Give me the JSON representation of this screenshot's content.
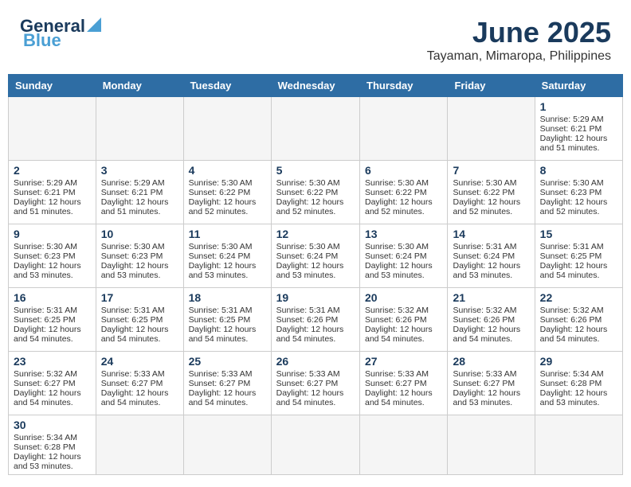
{
  "header": {
    "logo_general": "General",
    "logo_blue": "Blue",
    "month_year": "June 2025",
    "location": "Tayaman, Mimaropa, Philippines"
  },
  "weekdays": [
    "Sunday",
    "Monday",
    "Tuesday",
    "Wednesday",
    "Thursday",
    "Friday",
    "Saturday"
  ],
  "days": [
    {
      "num": "",
      "info": ""
    },
    {
      "num": "",
      "info": ""
    },
    {
      "num": "",
      "info": ""
    },
    {
      "num": "",
      "info": ""
    },
    {
      "num": "",
      "info": ""
    },
    {
      "num": "",
      "info": ""
    },
    {
      "num": "1",
      "sunrise": "Sunrise: 5:29 AM",
      "sunset": "Sunset: 6:21 PM",
      "daylight": "Daylight: 12 hours",
      "minutes": "and 51 minutes."
    },
    {
      "num": "2",
      "sunrise": "Sunrise: 5:29 AM",
      "sunset": "Sunset: 6:21 PM",
      "daylight": "Daylight: 12 hours",
      "minutes": "and 51 minutes."
    },
    {
      "num": "3",
      "sunrise": "Sunrise: 5:29 AM",
      "sunset": "Sunset: 6:21 PM",
      "daylight": "Daylight: 12 hours",
      "minutes": "and 51 minutes."
    },
    {
      "num": "4",
      "sunrise": "Sunrise: 5:30 AM",
      "sunset": "Sunset: 6:22 PM",
      "daylight": "Daylight: 12 hours",
      "minutes": "and 52 minutes."
    },
    {
      "num": "5",
      "sunrise": "Sunrise: 5:30 AM",
      "sunset": "Sunset: 6:22 PM",
      "daylight": "Daylight: 12 hours",
      "minutes": "and 52 minutes."
    },
    {
      "num": "6",
      "sunrise": "Sunrise: 5:30 AM",
      "sunset": "Sunset: 6:22 PM",
      "daylight": "Daylight: 12 hours",
      "minutes": "and 52 minutes."
    },
    {
      "num": "7",
      "sunrise": "Sunrise: 5:30 AM",
      "sunset": "Sunset: 6:22 PM",
      "daylight": "Daylight: 12 hours",
      "minutes": "and 52 minutes."
    },
    {
      "num": "8",
      "sunrise": "Sunrise: 5:30 AM",
      "sunset": "Sunset: 6:23 PM",
      "daylight": "Daylight: 12 hours",
      "minutes": "and 52 minutes."
    },
    {
      "num": "9",
      "sunrise": "Sunrise: 5:30 AM",
      "sunset": "Sunset: 6:23 PM",
      "daylight": "Daylight: 12 hours",
      "minutes": "and 53 minutes."
    },
    {
      "num": "10",
      "sunrise": "Sunrise: 5:30 AM",
      "sunset": "Sunset: 6:23 PM",
      "daylight": "Daylight: 12 hours",
      "minutes": "and 53 minutes."
    },
    {
      "num": "11",
      "sunrise": "Sunrise: 5:30 AM",
      "sunset": "Sunset: 6:24 PM",
      "daylight": "Daylight: 12 hours",
      "minutes": "and 53 minutes."
    },
    {
      "num": "12",
      "sunrise": "Sunrise: 5:30 AM",
      "sunset": "Sunset: 6:24 PM",
      "daylight": "Daylight: 12 hours",
      "minutes": "and 53 minutes."
    },
    {
      "num": "13",
      "sunrise": "Sunrise: 5:30 AM",
      "sunset": "Sunset: 6:24 PM",
      "daylight": "Daylight: 12 hours",
      "minutes": "and 53 minutes."
    },
    {
      "num": "14",
      "sunrise": "Sunrise: 5:31 AM",
      "sunset": "Sunset: 6:24 PM",
      "daylight": "Daylight: 12 hours",
      "minutes": "and 53 minutes."
    },
    {
      "num": "15",
      "sunrise": "Sunrise: 5:31 AM",
      "sunset": "Sunset: 6:25 PM",
      "daylight": "Daylight: 12 hours",
      "minutes": "and 54 minutes."
    },
    {
      "num": "16",
      "sunrise": "Sunrise: 5:31 AM",
      "sunset": "Sunset: 6:25 PM",
      "daylight": "Daylight: 12 hours",
      "minutes": "and 54 minutes."
    },
    {
      "num": "17",
      "sunrise": "Sunrise: 5:31 AM",
      "sunset": "Sunset: 6:25 PM",
      "daylight": "Daylight: 12 hours",
      "minutes": "and 54 minutes."
    },
    {
      "num": "18",
      "sunrise": "Sunrise: 5:31 AM",
      "sunset": "Sunset: 6:25 PM",
      "daylight": "Daylight: 12 hours",
      "minutes": "and 54 minutes."
    },
    {
      "num": "19",
      "sunrise": "Sunrise: 5:31 AM",
      "sunset": "Sunset: 6:26 PM",
      "daylight": "Daylight: 12 hours",
      "minutes": "and 54 minutes."
    },
    {
      "num": "20",
      "sunrise": "Sunrise: 5:32 AM",
      "sunset": "Sunset: 6:26 PM",
      "daylight": "Daylight: 12 hours",
      "minutes": "and 54 minutes."
    },
    {
      "num": "21",
      "sunrise": "Sunrise: 5:32 AM",
      "sunset": "Sunset: 6:26 PM",
      "daylight": "Daylight: 12 hours",
      "minutes": "and 54 minutes."
    },
    {
      "num": "22",
      "sunrise": "Sunrise: 5:32 AM",
      "sunset": "Sunset: 6:26 PM",
      "daylight": "Daylight: 12 hours",
      "minutes": "and 54 minutes."
    },
    {
      "num": "23",
      "sunrise": "Sunrise: 5:32 AM",
      "sunset": "Sunset: 6:27 PM",
      "daylight": "Daylight: 12 hours",
      "minutes": "and 54 minutes."
    },
    {
      "num": "24",
      "sunrise": "Sunrise: 5:33 AM",
      "sunset": "Sunset: 6:27 PM",
      "daylight": "Daylight: 12 hours",
      "minutes": "and 54 minutes."
    },
    {
      "num": "25",
      "sunrise": "Sunrise: 5:33 AM",
      "sunset": "Sunset: 6:27 PM",
      "daylight": "Daylight: 12 hours",
      "minutes": "and 54 minutes."
    },
    {
      "num": "26",
      "sunrise": "Sunrise: 5:33 AM",
      "sunset": "Sunset: 6:27 PM",
      "daylight": "Daylight: 12 hours",
      "minutes": "and 54 minutes."
    },
    {
      "num": "27",
      "sunrise": "Sunrise: 5:33 AM",
      "sunset": "Sunset: 6:27 PM",
      "daylight": "Daylight: 12 hours",
      "minutes": "and 54 minutes."
    },
    {
      "num": "28",
      "sunrise": "Sunrise: 5:33 AM",
      "sunset": "Sunset: 6:27 PM",
      "daylight": "Daylight: 12 hours",
      "minutes": "and 53 minutes."
    },
    {
      "num": "29",
      "sunrise": "Sunrise: 5:34 AM",
      "sunset": "Sunset: 6:28 PM",
      "daylight": "Daylight: 12 hours",
      "minutes": "and 53 minutes."
    },
    {
      "num": "30",
      "sunrise": "Sunrise: 5:34 AM",
      "sunset": "Sunset: 6:28 PM",
      "daylight": "Daylight: 12 hours",
      "minutes": "and 53 minutes."
    }
  ]
}
